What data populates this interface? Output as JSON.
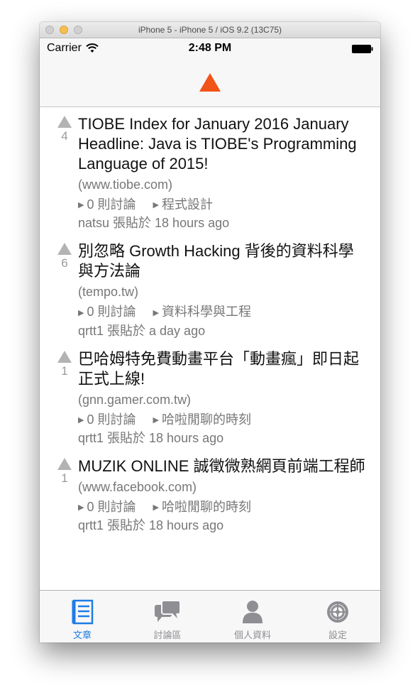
{
  "window": {
    "title": "iPhone 5 - iPhone 5 / iOS 9.2 (13C75)"
  },
  "status_bar": {
    "carrier": "Carrier",
    "time": "2:48 PM"
  },
  "nav": {
    "logo_color": "#f25316"
  },
  "posts": [
    {
      "votes": "4",
      "title": "TIOBE Index for January 2016 January Headline: Java is TIOBE's Programming Language of 2015!",
      "domain": "(www.tiobe.com)",
      "comments": "0 則討論",
      "category": "程式設計",
      "byline": "natsu 張貼於 18 hours ago"
    },
    {
      "votes": "6",
      "title": "別忽略 Growth Hacking 背後的資料科學與方法論",
      "domain": "(tempo.tw)",
      "comments": "0 則討論",
      "category": "資料科學與工程",
      "byline": "qrtt1 張貼於 a day ago"
    },
    {
      "votes": "1",
      "title": "巴哈姆特免費動畫平台「動畫瘋」即日起正式上線!",
      "domain": "(gnn.gamer.com.tw)",
      "comments": "0 則討論",
      "category": "哈啦閒聊的時刻",
      "byline": "qrtt1 張貼於 18 hours ago"
    },
    {
      "votes": "1",
      "title": "MUZIK ONLINE 誠徵微熟網頁前端工程師",
      "domain": "(www.facebook.com)",
      "comments": "0 則討論",
      "category": "哈啦閒聊的時刻",
      "byline": "qrtt1 張貼於 18 hours ago"
    }
  ],
  "tabs": [
    {
      "label": "文章",
      "icon": "articles-icon",
      "active": true
    },
    {
      "label": "討論區",
      "icon": "discussion-icon",
      "active": false
    },
    {
      "label": "個人資料",
      "icon": "profile-icon",
      "active": false
    },
    {
      "label": "設定",
      "icon": "settings-icon",
      "active": false
    }
  ],
  "colors": {
    "active_tab": "#1e7ce6",
    "inactive_tab": "#8e8e93"
  }
}
